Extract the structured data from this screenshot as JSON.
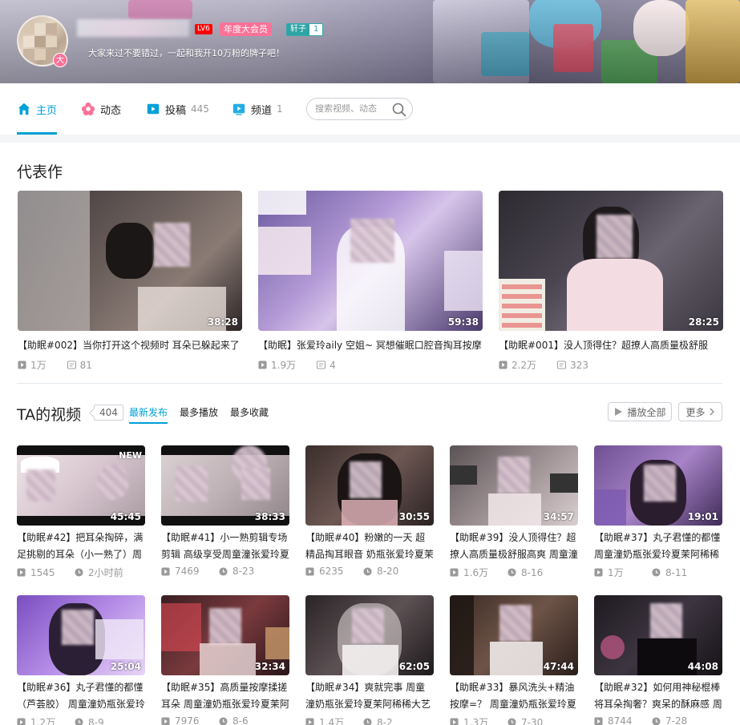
{
  "header": {
    "avatar_badge": "大",
    "level": "LV6",
    "vip_label": "年度大会员",
    "fan_badge_name": "轩子",
    "fan_badge_level": "1",
    "sign": "大家来过不要错过，一起和我开10万粉的牌子吧！"
  },
  "nav": {
    "home": "主页",
    "dynamic": "动态",
    "posts": "投稿",
    "posts_count": "445",
    "channel": "频道",
    "channel_count": "1",
    "search_placeholder": "搜索视频、动态"
  },
  "representative": {
    "title": "代表作",
    "items": [
      {
        "title": "【助眠#002】当你打开这个视频时 耳朵已躲起来了",
        "duration": "38:28",
        "plays": "1万",
        "danmaku": "81"
      },
      {
        "title": "【助眠】张爱玲aily 空姐~ 冥想催眠口腔音掏耳按摩",
        "duration": "59:38",
        "plays": "1.9万",
        "danmaku": "4"
      },
      {
        "title": "【助眠#001】没人顶得住？超撩人高质量极舒服",
        "duration": "28:25",
        "plays": "2.2万",
        "danmaku": "323"
      }
    ]
  },
  "videos": {
    "title": "TA的视频",
    "count": "404",
    "tabs": [
      "最新发布",
      "最多播放",
      "最多收藏"
    ],
    "play_all": "播放全部",
    "more": "更多",
    "items": [
      {
        "title": "【助眠#42】把耳朵掏碎，满足挑剔的耳朵（小一熟了）周",
        "duration": "45:45",
        "plays": "1545",
        "date": "2小时前",
        "tag": "NEW"
      },
      {
        "title": "【助眠#41】小一熟剪辑专场 剪辑 高级享受周童潼张爱玲夏",
        "duration": "38:33",
        "plays": "7469",
        "date": "8-23"
      },
      {
        "title": "【助眠#40】粉嫩的一天 超精品掏耳眼音 奶瓶张爱玲夏茉阿",
        "duration": "30:55",
        "plays": "6235",
        "date": "8-20"
      },
      {
        "title": "【助眠#39】没人顶得住？超撩人高质量极舒服高爽 周童潼",
        "duration": "34:57",
        "plays": "1.6万",
        "date": "8-16"
      },
      {
        "title": "【助眠#37】丸子君懂的都懂 周童潼奶瓶张爱玲夏茉阿稀稀",
        "duration": "19:01",
        "plays": "1万",
        "date": "8-11"
      },
      {
        "title": "【助眠#36】丸子君懂的都懂（芦荟胶） 周童潼奶瓶张爱玲",
        "duration": "25:04",
        "plays": "1.2万",
        "date": "8-9"
      },
      {
        "title": "【助眠#35】高质量按摩揉搓耳朵 周童潼奶瓶张爱玲夏茉阿",
        "duration": "32:34",
        "plays": "7976",
        "date": "8-6"
      },
      {
        "title": "【助眠#34】爽就完事 周童潼奶瓶张爱玲夏茉阿稀稀大艺术",
        "duration": "62:05",
        "plays": "1.4万",
        "date": "8-2"
      },
      {
        "title": "【助眠#33】暴风洗头+精油按摩=？ 周童潼奶瓶张爱玲夏",
        "duration": "47:44",
        "plays": "1.3万",
        "date": "7-30"
      },
      {
        "title": "【助眠#32】如何用神秘棍棒将耳朵掏奢？爽呆的酥麻感 周",
        "duration": "44:08",
        "plays": "8744",
        "date": "7-28"
      }
    ]
  },
  "colors": {
    "accent": "#00a1d6",
    "vip": "#fb7299",
    "level": "#ff0000",
    "fan": "#2fa4a5"
  }
}
